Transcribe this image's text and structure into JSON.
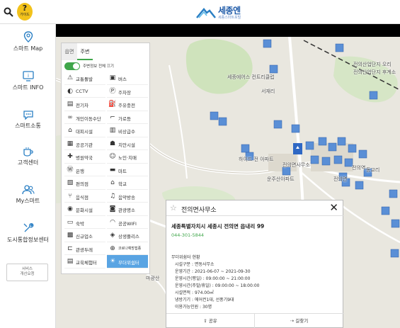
{
  "header": {
    "guide_q": "?",
    "guide_label": "가이드",
    "logo_name": "세종엔",
    "logo_sub": "세종스마트포털"
  },
  "sidebar": {
    "items": [
      {
        "label": "스마트 Map",
        "icon": "map-pin-icon"
      },
      {
        "label": "스마트 INFO",
        "icon": "info-monitor-icon"
      },
      {
        "label": "스마트소통",
        "icon": "chat-icon"
      },
      {
        "label": "고객센터",
        "icon": "coffee-cup-icon"
      },
      {
        "label": "My스마트",
        "icon": "users-icon"
      },
      {
        "label": "도시통합정보센터",
        "icon": "tools-icon"
      }
    ],
    "service_btn_line1": "서비스",
    "service_btn_line2": "개선요청"
  },
  "panel": {
    "tabs": [
      "읍면",
      "주변"
    ],
    "toggle_label": "주변정보 전체 끄기",
    "categories": [
      {
        "label": "교통돌발",
        "icon": "warning-icon"
      },
      {
        "label": "버스",
        "icon": "bus-icon"
      },
      {
        "label": "CCTV",
        "icon": "cctv-icon"
      },
      {
        "label": "주차장",
        "icon": "parking-icon"
      },
      {
        "label": "전기차",
        "icon": "ev-car-icon"
      },
      {
        "label": "주유충전",
        "icon": "fuel-icon"
      },
      {
        "label": "개인이동수단",
        "icon": "bike-icon"
      },
      {
        "label": "가로등",
        "icon": "streetlight-icon"
      },
      {
        "label": "대피시설",
        "icon": "shelter-icon"
      },
      {
        "label": "비상급수",
        "icon": "water-icon"
      },
      {
        "label": "공공기관",
        "icon": "building-icon"
      },
      {
        "label": "치안시설",
        "icon": "police-icon"
      },
      {
        "label": "병원약국",
        "icon": "hospital-icon"
      },
      {
        "label": "노인·치매",
        "icon": "elderly-icon"
      },
      {
        "label": "은행",
        "icon": "bank-icon"
      },
      {
        "label": "마트",
        "icon": "cart-icon"
      },
      {
        "label": "편의점",
        "icon": "store-icon"
      },
      {
        "label": "학교",
        "icon": "school-icon"
      },
      {
        "label": "음식점",
        "icon": "restaurant-icon"
      },
      {
        "label": "음악방송",
        "icon": "music-icon"
      },
      {
        "label": "문화시설",
        "icon": "culture-icon"
      },
      {
        "label": "관광명소",
        "icon": "camera-icon"
      },
      {
        "label": "숙박",
        "icon": "bed-icon"
      },
      {
        "label": "공공WIFI",
        "icon": "wifi-icon"
      },
      {
        "label": "신규업소",
        "icon": "new-shop-icon"
      },
      {
        "label": "상생플리스",
        "icon": "coop-icon"
      },
      {
        "label": "관광두레",
        "icon": "tour-icon"
      },
      {
        "label": "코로나예방접종",
        "icon": "vaccine-icon"
      },
      {
        "label": "교육체험터",
        "icon": "education-icon"
      },
      {
        "label": "무더위쉼터",
        "icon": "heat-shelter-icon"
      }
    ],
    "selected_category": "무더위쉼터"
  },
  "map": {
    "labels": [
      "세종에어스 컨트리클럽",
      "서재리",
      "전의산업단지 오리",
      "전의산업단지 후계소",
      "전의역",
      "운주산아파트",
      "전의면사무소",
      "하이드 전 아파트",
      "동교리",
      "전의면",
      "마광산"
    ]
  },
  "popup": {
    "title": "전의면사무소",
    "address": "세종특별자치시 세종시 전의면 읍내리 99",
    "phone": "044-301-5844",
    "section": "무더위쉼터 현황",
    "rows": [
      {
        "k": "시설구분",
        "v": "면동사무소"
      },
      {
        "k": "운영기간",
        "v": "2021-06-07 ~ 2021-09-30"
      },
      {
        "k": "운영시간(평일)",
        "v": "09:00:00 ~ 21:00:00"
      },
      {
        "k": "운영시간(주말/휴일)",
        "v": "09:00:00 ~ 18:00:00"
      },
      {
        "k": "시설면적",
        "v": "974.00㎡"
      },
      {
        "k": "냉방기기",
        "v": "에어컨1대, 선풍기9대"
      },
      {
        "k": "이용가능인원",
        "v": "30명"
      }
    ],
    "share_label": "공유",
    "route_label": "길찾기"
  }
}
